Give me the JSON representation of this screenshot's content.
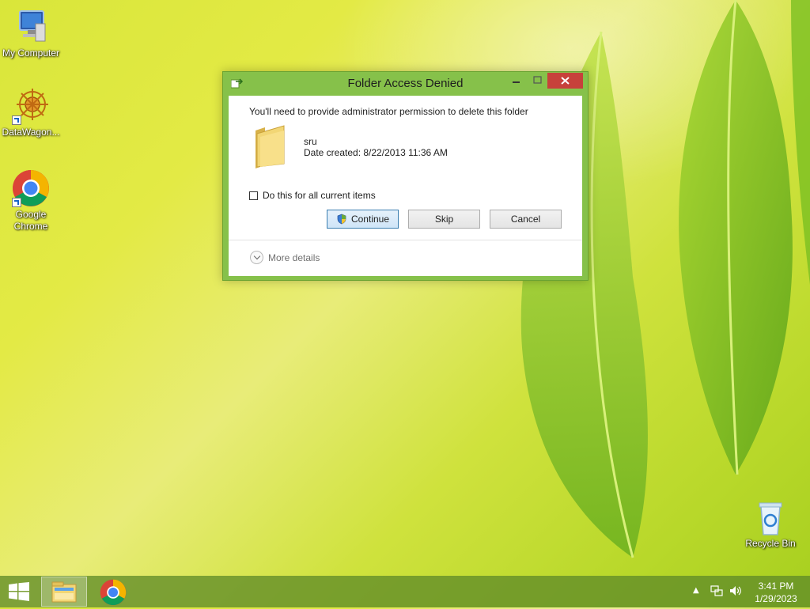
{
  "desktop": {
    "icons": [
      {
        "label": "My Computer"
      },
      {
        "label": "DataWagon..."
      },
      {
        "label": "Google Chrome"
      },
      {
        "label": "Recycle Bin"
      }
    ]
  },
  "dialog": {
    "title": "Folder Access Denied",
    "message": "You'll need to provide administrator permission to delete this folder",
    "item_name": "sru",
    "item_date": "Date created: 8/22/2013 11:36 AM",
    "checkbox_label": "Do this for all current items",
    "checkbox_checked": false,
    "buttons": {
      "continue": "Continue",
      "skip": "Skip",
      "cancel": "Cancel"
    },
    "more_details": "More details",
    "icons": {
      "app": "file-copy-icon",
      "folder": "folder-icon",
      "shield": "uac-shield-icon",
      "chevron": "chevron-down-icon"
    }
  },
  "taskbar": {
    "icons": [
      "windows-start-icon",
      "file-explorer-icon",
      "chrome-icon"
    ],
    "tray": [
      "show-hidden-icons-arrow",
      "network-icon",
      "volume-icon"
    ],
    "clock": {
      "time": "3:41 PM",
      "date": "1/29/2023"
    }
  },
  "colors": {
    "dialog_frame": "#86c14a",
    "close_button": "#c7413b",
    "taskbar": "#608c28",
    "default_button_border": "#3c7fb1"
  }
}
